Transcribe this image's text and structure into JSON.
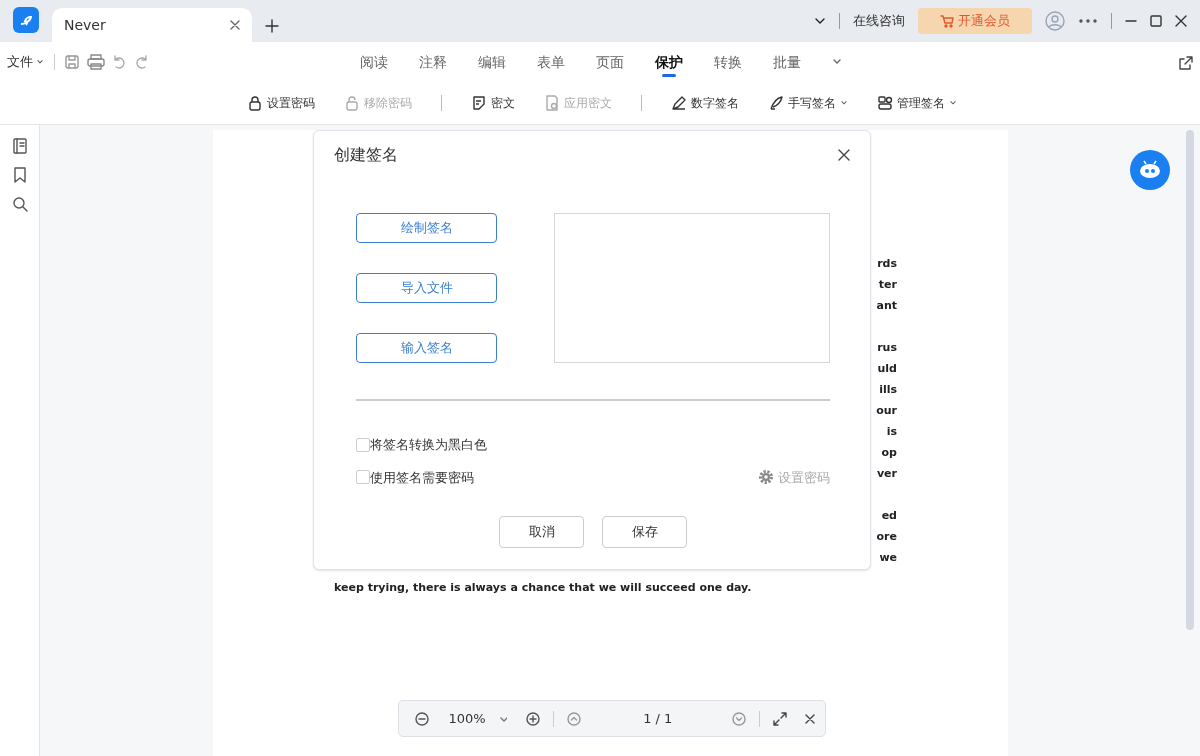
{
  "tabs": [
    {
      "label": "Never",
      "selected": true
    }
  ],
  "titlebar": {
    "consult": "在线咨询",
    "vip_button": "开通会员"
  },
  "file_menu": "文件",
  "menu_tabs": [
    {
      "label": "阅读",
      "selected": false
    },
    {
      "label": "注释",
      "selected": false
    },
    {
      "label": "编辑",
      "selected": false
    },
    {
      "label": "表单",
      "selected": false
    },
    {
      "label": "页面",
      "selected": false
    },
    {
      "label": "保护",
      "selected": true
    },
    {
      "label": "转换",
      "selected": false
    },
    {
      "label": "批量",
      "selected": false
    }
  ],
  "ribbon": [
    {
      "kind": "lock",
      "label": "设置密码",
      "disabled": false,
      "dropdown": false
    },
    {
      "kind": "unlock",
      "label": "移除密码",
      "disabled": true,
      "dropdown": false
    },
    {
      "kind": "divider"
    },
    {
      "kind": "note",
      "label": "密文",
      "disabled": false,
      "dropdown": false
    },
    {
      "kind": "doc",
      "label": "应用密文",
      "disabled": true,
      "dropdown": false
    },
    {
      "kind": "divider"
    },
    {
      "kind": "pen",
      "label": "数字签名",
      "disabled": false,
      "dropdown": false
    },
    {
      "kind": "quill",
      "label": "手写签名",
      "disabled": false,
      "dropdown": true
    },
    {
      "kind": "people",
      "label": "管理签名",
      "disabled": false,
      "dropdown": true
    }
  ],
  "document": {
    "fragments": [
      [
        "rds",
        "ter",
        "ant"
      ],
      [
        "rus",
        "uld",
        "ills",
        "our",
        "is",
        "op",
        "ver"
      ],
      [
        "ed",
        "ore",
        "we"
      ]
    ],
    "last_line": "keep trying, there is always a chance that we will succeed one day."
  },
  "dialog": {
    "title": "创建签名",
    "buttons": [
      "绘制签名",
      "导入文件",
      "输入签名"
    ],
    "options": [
      {
        "label": "将签名转换为黑白色",
        "checked": false
      },
      {
        "label": "使用签名需要密码",
        "checked": false
      }
    ],
    "set_password": {
      "label": "设置密码",
      "disabled": true
    },
    "cancel": "取消",
    "save": "保存"
  },
  "zoom_bar": {
    "zoom": "100%",
    "page": "1 / 1"
  }
}
